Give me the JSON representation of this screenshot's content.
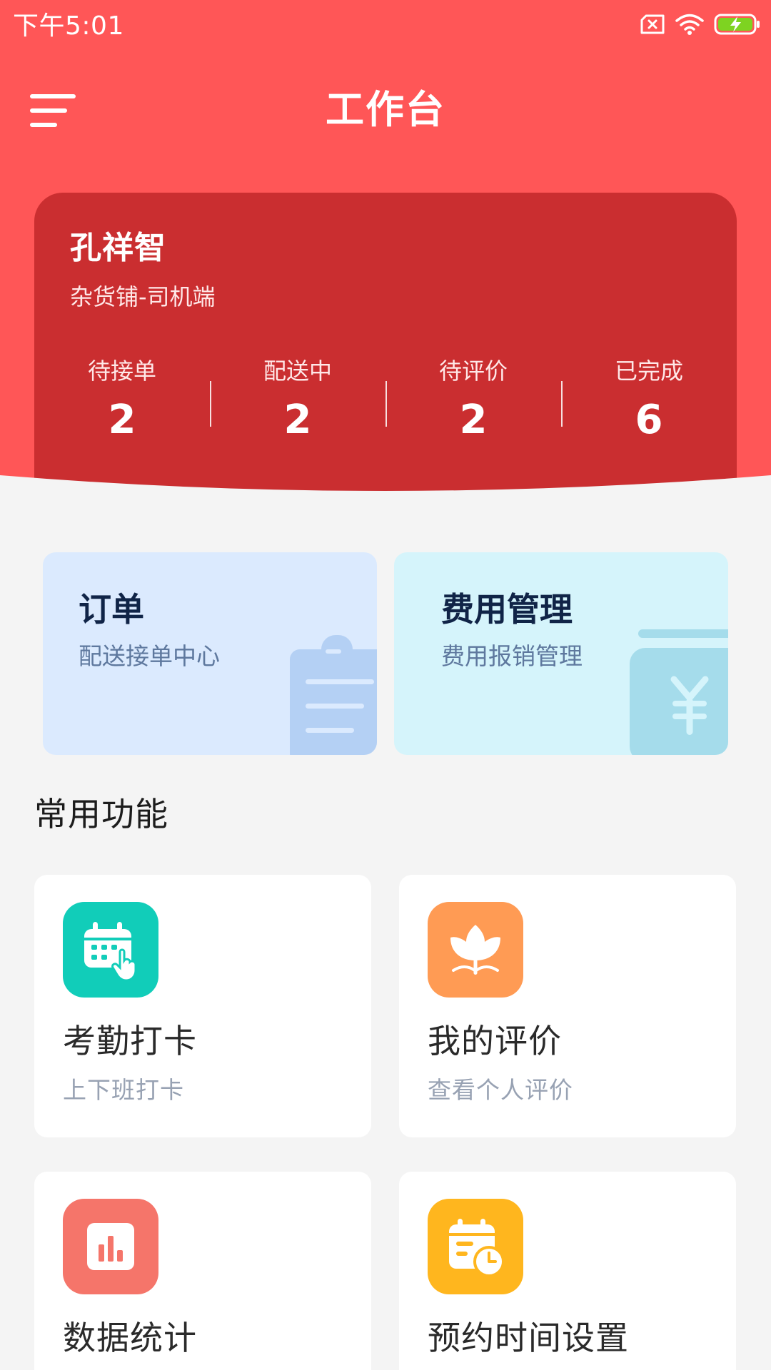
{
  "status_bar": {
    "time": "下午5:01",
    "icons": [
      "sim-card-x-icon",
      "wifi-icon",
      "battery-charging-icon"
    ]
  },
  "header": {
    "title": "工作台",
    "menu_icon": "menu-icon"
  },
  "user_card": {
    "name": "孔祥智",
    "role": "杂货铺-司机端",
    "stats": [
      {
        "label": "待接单",
        "value": "2"
      },
      {
        "label": "配送中",
        "value": "2"
      },
      {
        "label": "待评价",
        "value": "2"
      },
      {
        "label": "已完成",
        "value": "6"
      }
    ]
  },
  "feature_cards": [
    {
      "title": "订单",
      "subtitle": "配送接单中心",
      "icon": "clipboard-icon"
    },
    {
      "title": "费用管理",
      "subtitle": "费用报销管理",
      "icon": "wallet-yen-icon"
    }
  ],
  "common_functions": {
    "section_title": "常用功能",
    "items": [
      {
        "title": "考勤打卡",
        "subtitle": "上下班打卡",
        "icon": "calendar-tap-icon",
        "color": "#11CDB9"
      },
      {
        "title": "我的评价",
        "subtitle": "查看个人评价",
        "icon": "flower-icon",
        "color": "#FF9B54"
      },
      {
        "title": "数据统计",
        "subtitle": "",
        "icon": "bar-chart-icon",
        "color": "#F5756A"
      },
      {
        "title": "预约时间设置",
        "subtitle": "",
        "icon": "schedule-clock-icon",
        "color": "#FFB61E"
      }
    ]
  },
  "colors": {
    "header_red": "#FF5657",
    "card_red": "#CA2E30",
    "background": "#F4F4F4"
  }
}
